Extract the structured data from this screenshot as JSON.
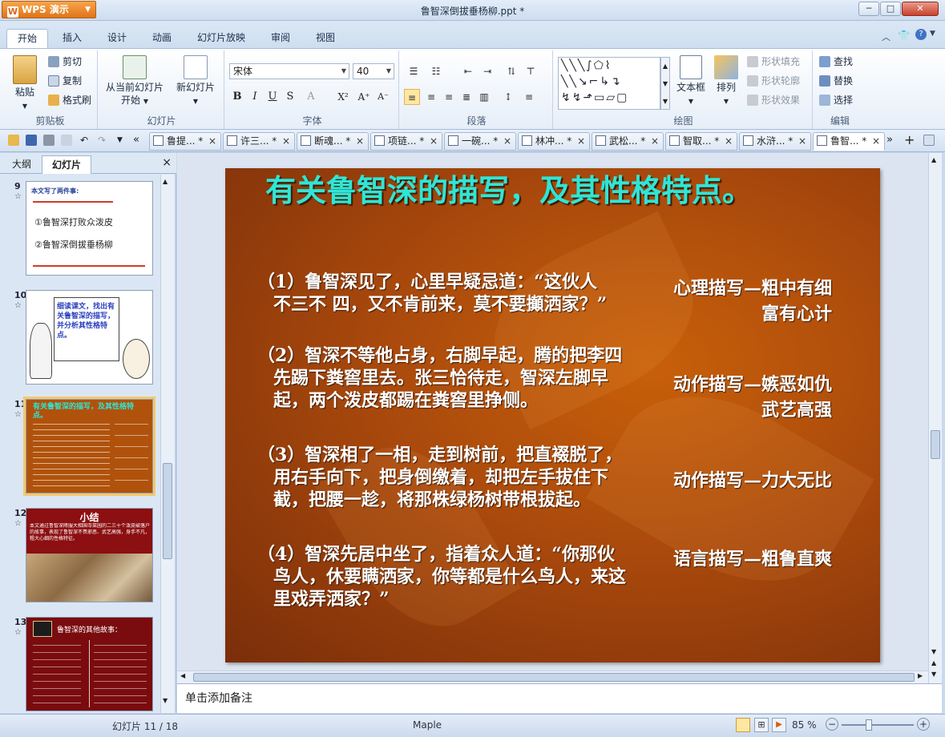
{
  "app": {
    "name": "WPS 演示",
    "window_title": "鲁智深倒拔垂杨柳.ppt *"
  },
  "ribbon_tabs": [
    "开始",
    "插入",
    "设计",
    "动画",
    "幻灯片放映",
    "审阅",
    "视图"
  ],
  "ribbon": {
    "clipboard": {
      "paste": "粘贴",
      "cut": "剪切",
      "copy": "复制",
      "format_painter": "格式刷",
      "label": "剪贴板"
    },
    "slides": {
      "from_current": "从当前幻灯片",
      "start": "开始",
      "new_slide": "新幻灯片",
      "label": "幻灯片"
    },
    "font": {
      "name": "宋体",
      "size": "40",
      "label": "字体",
      "bold": "B",
      "italic": "I",
      "underline": "U",
      "shadow": "S",
      "color": "A",
      "superscript": "X²",
      "grow": "A⁺",
      "shrink": "A⁻"
    },
    "paragraph": {
      "label": "段落"
    },
    "drawing": {
      "textbox": "文本框",
      "arrange": "排列",
      "shape_fill": "形状填充",
      "shape_outline": "形状轮廓",
      "shape_effect": "形状效果",
      "label": "绘图"
    },
    "editing": {
      "find": "查找",
      "replace": "替换",
      "select": "选择",
      "label": "编辑"
    }
  },
  "doc_tabs": [
    "鲁提... *",
    "许三... *",
    "断魂... *",
    "项链... *",
    "一碗... *",
    "林冲... *",
    "武松... *",
    "智取... *",
    "水浒... *",
    "鲁智... *"
  ],
  "left_panel": {
    "tabs": [
      "大纲",
      "幻灯片"
    ],
    "close": "×"
  },
  "thumbnails": [
    {
      "num": "9",
      "title": "本文写了两件事:",
      "lines": [
        "①鲁智深打败众泼皮",
        "②鲁智深倒拔垂杨柳"
      ]
    },
    {
      "num": "10",
      "text": "细读课文，找出有关鲁智深的描写，并分析其性格特点。"
    },
    {
      "num": "11",
      "title": "有关鲁智深的描写，及其性格特点。"
    },
    {
      "num": "12",
      "title": "小结",
      "text": "本文通过鲁智深降服大相国寺菜园的二三十个泼皮破落户的故事，表现了鲁智深不畏邪恶、武艺高强，身手不凡，粗大心细的性格特征。"
    },
    {
      "num": "13",
      "title": "鲁智深的其他故事："
    }
  ],
  "slide": {
    "title": "有关鲁智深的描写，及其性格特点。",
    "paragraphs": [
      "（1）鲁智深见了，心里早疑忌道：“这伙人不三不 四，又不肯前来，莫不要攧洒家？”",
      "（2）智深不等他占身，右脚早起，腾的把李四先踢下粪窖里去。张三恰待走，智深左脚早起，两个泼皮都踢在粪窖里挣侧。",
      "（3）智深相了一相，走到树前，把直裰脱了，用右手向下，把身倒缴着，却把左手拔住下截，把腰一趁，将那株绿杨树带根拔起。",
      "（4）智深先居中坐了，指着众人道：“你那伙鸟人，休要瞒洒家，你等都是什么鸟人，来这里戏弄洒家？”"
    ],
    "notes": [
      [
        "心理描写—粗中有细",
        "富有心计"
      ],
      [
        "动作描写—嫉恶如仇",
        "武艺高强"
      ],
      [
        "动作描写—力大无比"
      ],
      [
        "语言描写—粗鲁直爽"
      ]
    ]
  },
  "notes_placeholder": "单击添加备注",
  "status": {
    "slide_pos": "幻灯片 11 / 18",
    "theme": "Maple",
    "zoom": "85 %"
  },
  "colors": {
    "title": "#2ee6d6",
    "slide_bg": "#a9490c",
    "selected": "#f5c96a"
  }
}
